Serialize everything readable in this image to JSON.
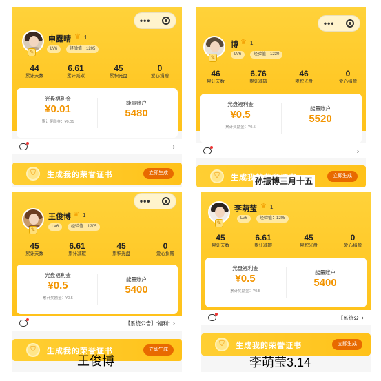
{
  "panels": [
    {
      "username": "申露晴",
      "level_num": "1",
      "level_badge": "LV6",
      "exp": "经验值：1205",
      "stats": [
        {
          "value": "44",
          "label": "累计天数"
        },
        {
          "value": "6.61",
          "label": "累计减碳"
        },
        {
          "value": "45",
          "label": "累积光盘"
        },
        {
          "value": "0",
          "label": "爱心捐赠"
        }
      ],
      "welfare_title": "光盘福利金",
      "welfare_value": "¥0.01",
      "welfare_sub": "累计奖励金：¥0.01",
      "energy_title": "能量账户",
      "energy_value": "5480",
      "notice_text": "",
      "banner_text": "生成我的荣誉证书",
      "banner_button": "立即生成"
    },
    {
      "username": "博",
      "level_num": "1",
      "level_badge": "LV6",
      "exp": "经验值：1230",
      "stats": [
        {
          "value": "46",
          "label": "累计天数"
        },
        {
          "value": "6.76",
          "label": "累计减碳"
        },
        {
          "value": "46",
          "label": "累积光盘"
        },
        {
          "value": "0",
          "label": "爱心捐赠"
        }
      ],
      "welfare_title": "光盘福利金",
      "welfare_value": "¥0.5",
      "welfare_sub": "累计奖励金：¥0.5",
      "energy_title": "能量账户",
      "energy_value": "5520",
      "notice_text": "",
      "banner_text": "生成我的荣誉证书",
      "banner_button": "立即生成",
      "overlay_caption": "孙振博三月十五"
    },
    {
      "username": "王俊博",
      "level_num": "1",
      "level_badge": "LV6",
      "exp": "经验值：1205",
      "stats": [
        {
          "value": "45",
          "label": "累计天数"
        },
        {
          "value": "6.61",
          "label": "累计减碳"
        },
        {
          "value": "45",
          "label": "累积光盘"
        },
        {
          "value": "0",
          "label": "爱心捐赠"
        }
      ],
      "welfare_title": "光盘福利金",
      "welfare_value": "¥0.5",
      "welfare_sub": "累计奖励金：¥0.5",
      "energy_title": "能量账户",
      "energy_value": "5400",
      "notice_text": "【系统公告】“福利”",
      "banner_text": "生成我的荣誉证书",
      "banner_button": "立即生成",
      "overlay_caption": "王俊博"
    },
    {
      "username": "李萌莹",
      "level_num": "1",
      "level_badge": "LV6",
      "exp": "经验值：1205",
      "stats": [
        {
          "value": "45",
          "label": "累计天数"
        },
        {
          "value": "6.61",
          "label": "累计减碳"
        },
        {
          "value": "45",
          "label": "累积光盘"
        },
        {
          "value": "0",
          "label": "爱心捐赠"
        }
      ],
      "welfare_title": "光盘福利金",
      "welfare_value": "¥0.5",
      "welfare_sub": "累计奖励金：¥0.5",
      "energy_title": "能量账户",
      "energy_value": "5400",
      "notice_text": "【系统公",
      "banner_text": "生成我的荣誉证书",
      "banner_button": "立即生成",
      "overlay_caption": "李萌莹3.14"
    }
  ],
  "icons": {
    "capsule_more": "more-dots-icon",
    "capsule_close": "target-close-icon",
    "message": "message-icon",
    "shield": "shield-icon",
    "crown": "crown-icon"
  },
  "colors": {
    "header_yellow": "#ffc21a",
    "value_orange": "#f29400",
    "button_orange": "#e86a00"
  }
}
